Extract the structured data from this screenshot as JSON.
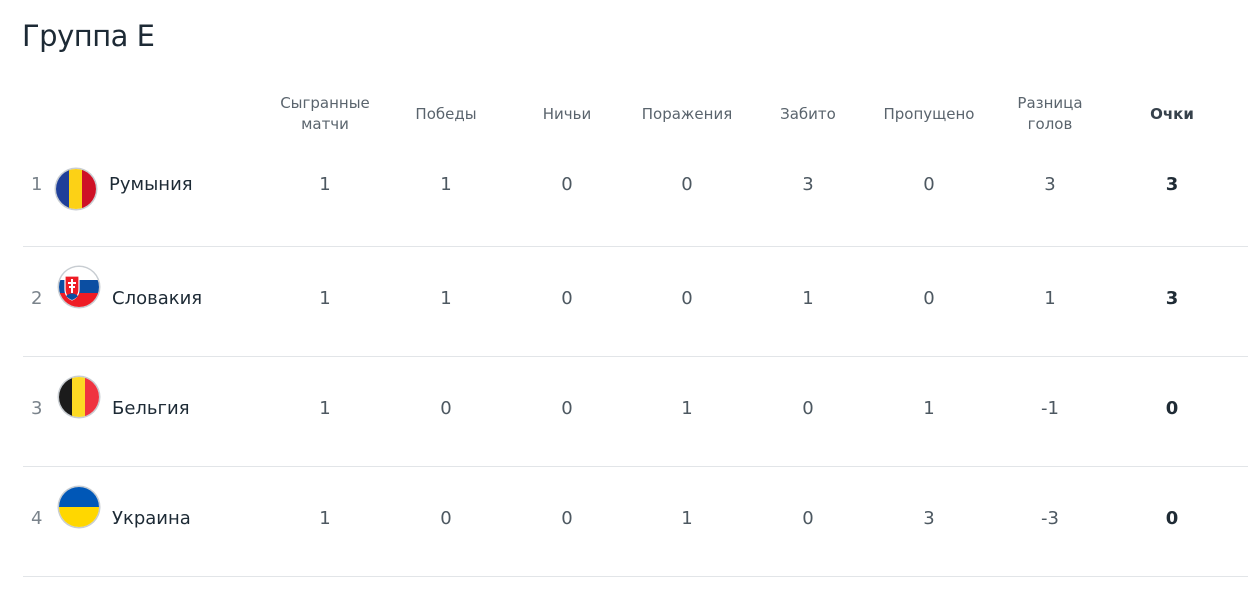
{
  "group_title": "Группа E",
  "headers": {
    "played": "Сыгранные матчи",
    "won": "Победы",
    "drawn": "Ничьи",
    "lost": "Поражения",
    "goals_for": "Забито",
    "goals_against": "Пропущено",
    "goal_diff": "Разница голов",
    "points": "Очки"
  },
  "rows": [
    {
      "rank": "1",
      "team": "Румыния",
      "flag_icon": "romania-flag-icon",
      "played": "1",
      "won": "1",
      "drawn": "0",
      "lost": "0",
      "goals_for": "3",
      "goals_against": "0",
      "goal_diff": "3",
      "points": "3"
    },
    {
      "rank": "2",
      "team": "Словакия",
      "flag_icon": "slovakia-flag-icon",
      "played": "1",
      "won": "1",
      "drawn": "0",
      "lost": "0",
      "goals_for": "1",
      "goals_against": "0",
      "goal_diff": "1",
      "points": "3"
    },
    {
      "rank": "3",
      "team": "Бельгия",
      "flag_icon": "belgium-flag-icon",
      "played": "1",
      "won": "0",
      "drawn": "0",
      "lost": "1",
      "goals_for": "0",
      "goals_against": "1",
      "goal_diff": "-1",
      "points": "0"
    },
    {
      "rank": "4",
      "team": "Украина",
      "flag_icon": "ukraine-flag-icon",
      "played": "1",
      "won": "0",
      "drawn": "0",
      "lost": "1",
      "goals_for": "0",
      "goals_against": "3",
      "goal_diff": "-3",
      "points": "0"
    }
  ],
  "colors": {
    "divider": "#e2e5e8",
    "header_text": "#5a646d",
    "body_text": "#1d2a35"
  }
}
